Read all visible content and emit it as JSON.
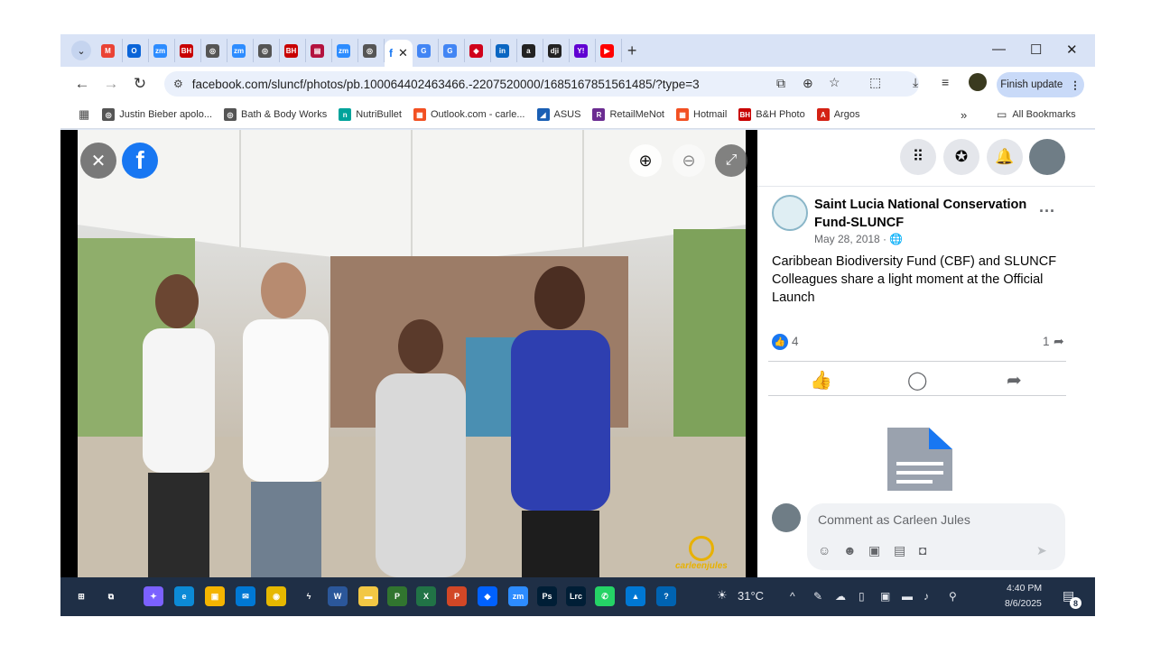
{
  "browser": {
    "tabs": [
      {
        "icon": "gmail-icon",
        "color": "#ea4335",
        "glyph": "M"
      },
      {
        "icon": "outlook-icon",
        "color": "#0a64d8",
        "glyph": "O"
      },
      {
        "icon": "zoom-icon",
        "color": "#2d8cff",
        "glyph": "zm"
      },
      {
        "icon": "bh-icon",
        "color": "#c80000",
        "glyph": "BH"
      },
      {
        "icon": "globe-icon",
        "color": "#555555",
        "glyph": "◎"
      },
      {
        "icon": "zoom-icon",
        "color": "#2d8cff",
        "glyph": "zm"
      },
      {
        "icon": "globe-icon",
        "color": "#555555",
        "glyph": "◎"
      },
      {
        "icon": "bh-icon",
        "color": "#c80000",
        "glyph": "BH"
      },
      {
        "icon": "news-icon",
        "color": "#b3123f",
        "glyph": "▤"
      },
      {
        "icon": "zoom-icon",
        "color": "#2d8cff",
        "glyph": "zm"
      },
      {
        "icon": "globe-icon",
        "color": "#555555",
        "glyph": "◎"
      },
      {
        "icon": "google-icon",
        "color": "#4285f4",
        "glyph": "G"
      },
      {
        "icon": "google-icon",
        "color": "#4285f4",
        "glyph": "G"
      },
      {
        "icon": "bank-icon",
        "color": "#d0021b",
        "glyph": "◈"
      },
      {
        "icon": "linkedin-icon",
        "color": "#0a66c2",
        "glyph": "in"
      },
      {
        "icon": "amazon-icon",
        "color": "#222222",
        "glyph": "a"
      },
      {
        "icon": "dji-icon",
        "color": "#222222",
        "glyph": "dji"
      },
      {
        "icon": "yahoo-icon",
        "color": "#6001d2",
        "glyph": "Y!"
      },
      {
        "icon": "youtube-icon",
        "color": "#ff0000",
        "glyph": "▶"
      }
    ],
    "active_tab": {
      "icon": "facebook-icon",
      "glyph": "f",
      "close": "✕"
    },
    "new_tab": "+",
    "window_controls": {
      "minimize": "—",
      "maximize": "☐",
      "close": "✕"
    },
    "url": "facebook.com/sluncf/photos/pb.100064402463466.-2207520000/1685167851561485/?type=3",
    "finish_update": "Finish update",
    "bookmarks": [
      {
        "label": "Justin Bieber apolo...",
        "icon": "globe-icon",
        "color": "#555555",
        "glyph": "◎"
      },
      {
        "label": "Bath & Body Works",
        "icon": "globe-icon",
        "color": "#555555",
        "glyph": "◎"
      },
      {
        "label": "NutriBullet",
        "icon": "nutribullet-icon",
        "color": "#00a39b",
        "glyph": "n"
      },
      {
        "label": "Outlook.com - carle...",
        "icon": "microsoft-icon",
        "color": "#f25022",
        "glyph": "▦"
      },
      {
        "label": "ASUS",
        "icon": "asus-icon",
        "color": "#1a5fb4",
        "glyph": "◢"
      },
      {
        "label": "RetailMeNot",
        "icon": "retailmenot-icon",
        "color": "#6b2c91",
        "glyph": "R"
      },
      {
        "label": "Hotmail",
        "icon": "microsoft-icon",
        "color": "#f25022",
        "glyph": "▦"
      },
      {
        "label": "B&H Photo",
        "icon": "bh-icon",
        "color": "#c80000",
        "glyph": "BH"
      },
      {
        "label": "Argos",
        "icon": "argos-icon",
        "color": "#d42114",
        "glyph": "A"
      }
    ],
    "bookmarks_overflow": "»",
    "all_bookmarks": "All Bookmarks"
  },
  "post": {
    "author": "Saint Lucia National Conservation Fund-SLUNCF",
    "date": "May 28, 2018 · ",
    "text": "Caribbean Biodiversity Fund (CBF) and SLUNCF Colleagues share a light moment at the Official Launch",
    "like_count": "4",
    "share_count": "1",
    "comment_placeholder": "Comment as Carleen Jules"
  },
  "photo": {
    "watermark": "carleenjules"
  },
  "taskbar": {
    "weather": "31°C",
    "time": "4:40 PM",
    "date": "8/6/2025",
    "notifications": "8",
    "apps": [
      {
        "icon": "start-icon",
        "color": "#ffffff",
        "glyph": "⊞"
      },
      {
        "icon": "task-view-icon",
        "color": "#ffffff",
        "glyph": "⧉"
      },
      {
        "icon": "copilot-icon",
        "color": "#7b61ff",
        "glyph": "✦"
      },
      {
        "icon": "edge-icon",
        "color": "#0c8ad6",
        "glyph": "e"
      },
      {
        "icon": "store-icon",
        "color": "#f4b400",
        "glyph": "▣"
      },
      {
        "icon": "mail-icon",
        "color": "#0078d4",
        "glyph": "✉"
      },
      {
        "icon": "chrome-icon",
        "color": "#e6b800",
        "glyph": "◉"
      },
      {
        "icon": "lightning-icon",
        "color": "#ffffff",
        "glyph": "ϟ"
      },
      {
        "icon": "word-icon",
        "color": "#2b579a",
        "glyph": "W"
      },
      {
        "icon": "file-explorer-icon",
        "color": "#f2c744",
        "glyph": "▬"
      },
      {
        "icon": "project-icon",
        "color": "#31752f",
        "glyph": "P"
      },
      {
        "icon": "excel-icon",
        "color": "#217346",
        "glyph": "X"
      },
      {
        "icon": "powerpoint-icon",
        "color": "#d24726",
        "glyph": "P"
      },
      {
        "icon": "dropbox-icon",
        "color": "#0061fe",
        "glyph": "◆"
      },
      {
        "icon": "zoom-icon",
        "color": "#2d8cff",
        "glyph": "zm"
      },
      {
        "icon": "photoshop-icon",
        "color": "#001e36",
        "glyph": "Ps"
      },
      {
        "icon": "lightroom-icon",
        "color": "#001e36",
        "glyph": "Lrc"
      },
      {
        "icon": "whatsapp-icon",
        "color": "#25d366",
        "glyph": "✆"
      },
      {
        "icon": "photos-icon",
        "color": "#0078d4",
        "glyph": "▲"
      },
      {
        "icon": "help-icon",
        "color": "#0063b1",
        "glyph": "?"
      }
    ]
  }
}
